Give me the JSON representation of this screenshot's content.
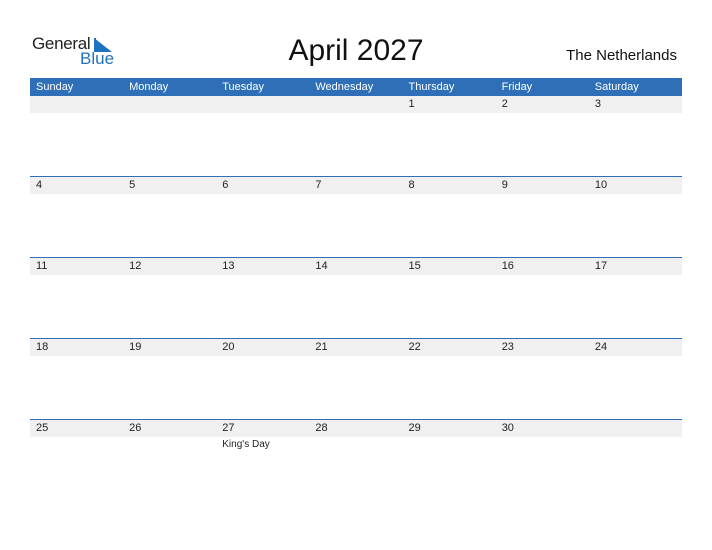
{
  "logo": {
    "general": "General",
    "blue": "Blue"
  },
  "title": "April 2027",
  "country": "The Netherlands",
  "accent_color": "#2e6fb7",
  "weekdays": [
    "Sunday",
    "Monday",
    "Tuesday",
    "Wednesday",
    "Thursday",
    "Friday",
    "Saturday"
  ],
  "weeks": [
    [
      "",
      "",
      "",
      "",
      "1",
      "2",
      "3"
    ],
    [
      "4",
      "5",
      "6",
      "7",
      "8",
      "9",
      "10"
    ],
    [
      "11",
      "12",
      "13",
      "14",
      "15",
      "16",
      "17"
    ],
    [
      "18",
      "19",
      "20",
      "21",
      "22",
      "23",
      "24"
    ],
    [
      "25",
      "26",
      "27",
      "28",
      "29",
      "30",
      ""
    ]
  ],
  "events": {
    "27": "King's Day"
  }
}
